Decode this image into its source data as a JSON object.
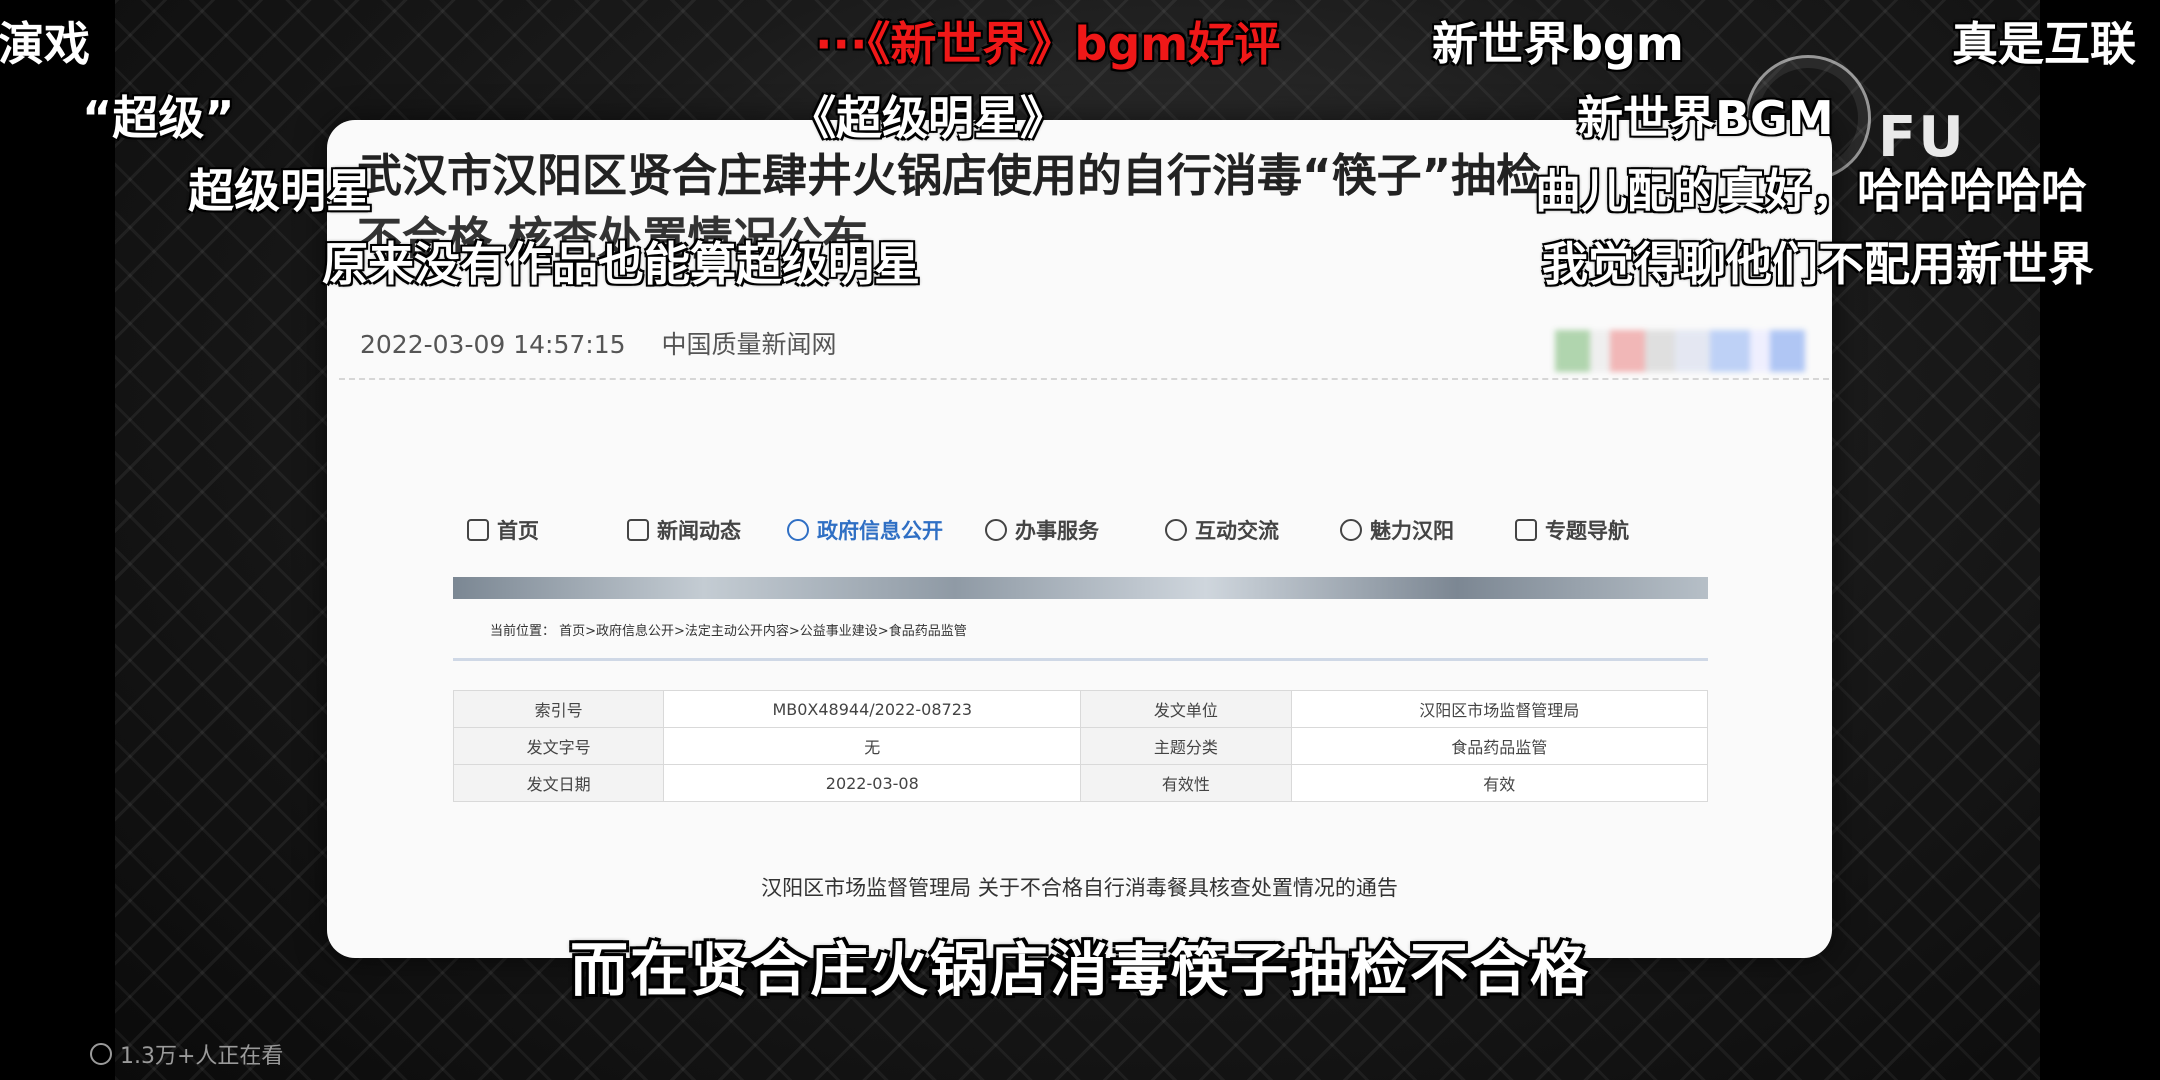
{
  "article": {
    "title_line1": "武汉市汉阳区贤合庄肆井火锅店使用的自行消毒“筷子”抽检",
    "title_line2": "不合格 核查处置情况公布",
    "date": "2022-03-09 14:57:15",
    "source": "中国质量新闻网"
  },
  "site": {
    "nav": [
      {
        "label": "首页",
        "icon": "home-icon"
      },
      {
        "label": "新闻动态",
        "icon": "news-icon"
      },
      {
        "label": "政府信息公开",
        "icon": "user-icon",
        "active": true
      },
      {
        "label": "办事服务",
        "icon": "service-icon"
      },
      {
        "label": "互动交流",
        "icon": "chat-icon"
      },
      {
        "label": "魅力汉阳",
        "icon": "location-icon"
      },
      {
        "label": "专题导航",
        "icon": "grid-icon"
      }
    ],
    "breadcrumb": "当前位置： 首页>政府信息公开>法定主动公开内容>公益事业建设>食品药品监管",
    "info_table": [
      [
        "索引号",
        "MB0X48944/2022-08723",
        "发文单位",
        "汉阳区市场监督管理局"
      ],
      [
        "发文字号",
        "无",
        "主题分类",
        "食品药品监管"
      ],
      [
        "发文日期",
        "2022-03-08",
        "有效性",
        "有效"
      ]
    ],
    "notice_title": "汉阳区市场监督管理局 关于不合格自行消毒餐具核查处置情况的通告"
  },
  "danmaku": [
    {
      "text": "演戏",
      "color": "#ffffff"
    },
    {
      "text": "···《新世界》bgm好评",
      "color": "#f01818"
    },
    {
      "text": "新世界bgm",
      "color": "#ffffff"
    },
    {
      "text": "真是互联",
      "color": "#ffffff"
    },
    {
      "text": "“超级”",
      "color": "#ffffff"
    },
    {
      "text": "《超级明星》",
      "color": "#ffffff"
    },
    {
      "text": "新世界BGM",
      "color": "#ffffff"
    },
    {
      "text": "超级明星",
      "color": "#ffffff"
    },
    {
      "text": "曲儿配的真好，哈哈哈哈哈",
      "color": "#ffffff"
    },
    {
      "text": "原来没有作品也能算超级明星",
      "color": "#ffffff"
    },
    {
      "text": "我觉得聊他们不配用新世界",
      "color": "#ffffff"
    }
  ],
  "watermark": "FU",
  "subtitle": "而在贤合庄火锅店消毒筷子抽检不合格",
  "viewers": "1.3万+人正在看"
}
